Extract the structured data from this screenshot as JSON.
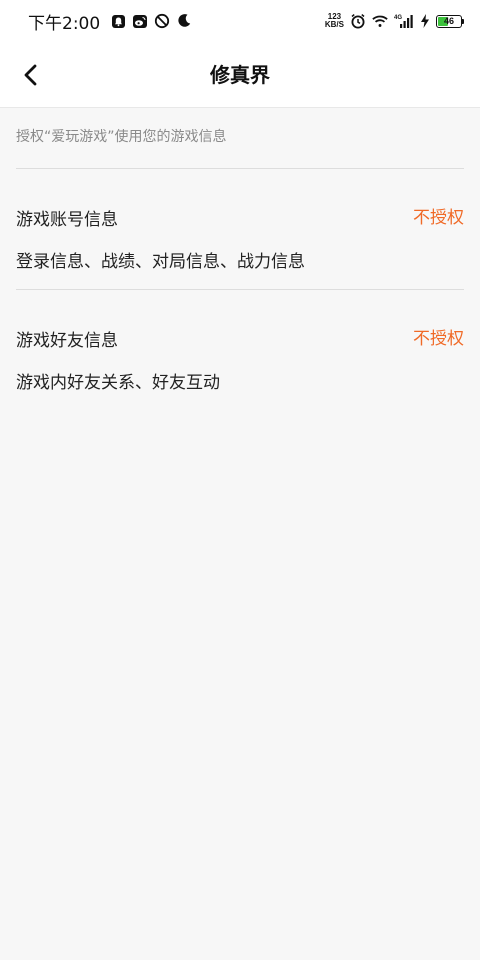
{
  "status_bar": {
    "time": "下午2:00",
    "net_speed_value": "123",
    "net_speed_unit": "KB/S",
    "network_type": "4G",
    "battery_level": "46",
    "battery_fraction": 0.46,
    "icons": [
      "notification-icon",
      "weibo-icon",
      "block-icon",
      "moon-icon",
      "alarm-icon",
      "wifi-icon",
      "signal-icon",
      "charging-icon",
      "battery-icon"
    ]
  },
  "nav": {
    "title": "修真界",
    "back_icon": "back-arrow-icon"
  },
  "auth": {
    "description": "授权“爱玩游戏”使用您的游戏信息"
  },
  "permissions": [
    {
      "title": "游戏账号信息",
      "status": "不授权",
      "detail": "登录信息、战绩、对局信息、战力信息"
    },
    {
      "title": "游戏好友信息",
      "status": "不授权",
      "detail": "游戏内好友关系、好友互动"
    }
  ],
  "colors": {
    "accent": "#f06a27",
    "background": "#f7f7f7",
    "header": "#ffffff",
    "battery_fill": "#3cc23c"
  }
}
